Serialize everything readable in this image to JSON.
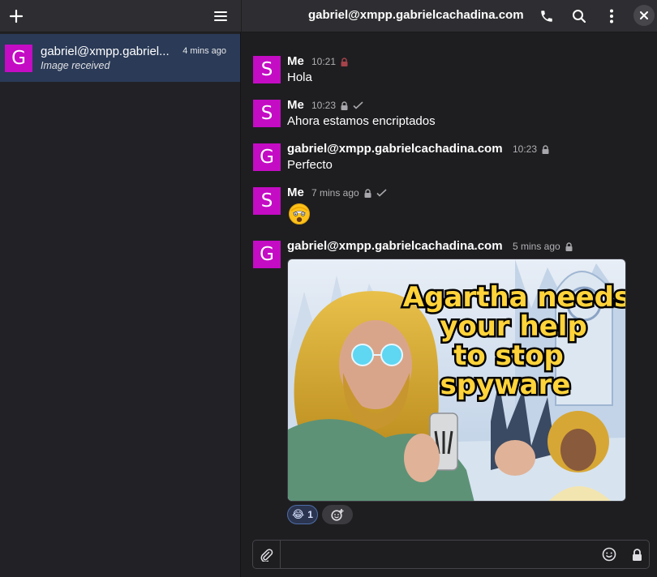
{
  "sidebar": {
    "conversation": {
      "avatar_letter": "G",
      "name": "gabriel@xmpp.gabriel...",
      "time": "4 mins ago",
      "preview": "Image received"
    }
  },
  "chat": {
    "title": "gabriel@xmpp.gabrielcachadina.com",
    "messages": [
      {
        "avatar_letter": "S",
        "sender": "Me",
        "time": "10:21",
        "body": "Hola"
      },
      {
        "avatar_letter": "S",
        "sender": "Me",
        "time": "10:23",
        "body": "Ahora estamos encriptados"
      },
      {
        "avatar_letter": "G",
        "sender": "gabriel@xmpp.gabrielcachadina.com",
        "time": "10:23",
        "body": "Perfecto"
      },
      {
        "avatar_letter": "S",
        "sender": "Me",
        "time": "7 mins ago",
        "body": ""
      },
      {
        "avatar_letter": "G",
        "sender": "gabriel@xmpp.gabrielcachadina.com",
        "time": "5 mins ago",
        "body": ""
      }
    ],
    "image": {
      "text_lines": [
        "Agartha needs",
        "your help",
        "to stop",
        "spyware"
      ]
    },
    "reaction": {
      "emoji": "😂",
      "count": "1"
    }
  },
  "composer": {
    "placeholder": ""
  },
  "colors": {
    "avatar": "#c40cc4",
    "selected_row": "#2a3a57",
    "header": "#2e2e32",
    "background": "#1e1e21"
  },
  "icons": [
    "plus-icon",
    "menu-icon",
    "phone-icon",
    "search-icon",
    "more-vertical-icon",
    "close-icon",
    "lock-icon",
    "checkmark-icon",
    "paperclip-icon",
    "emoji-icon",
    "add-reaction-icon"
  ]
}
